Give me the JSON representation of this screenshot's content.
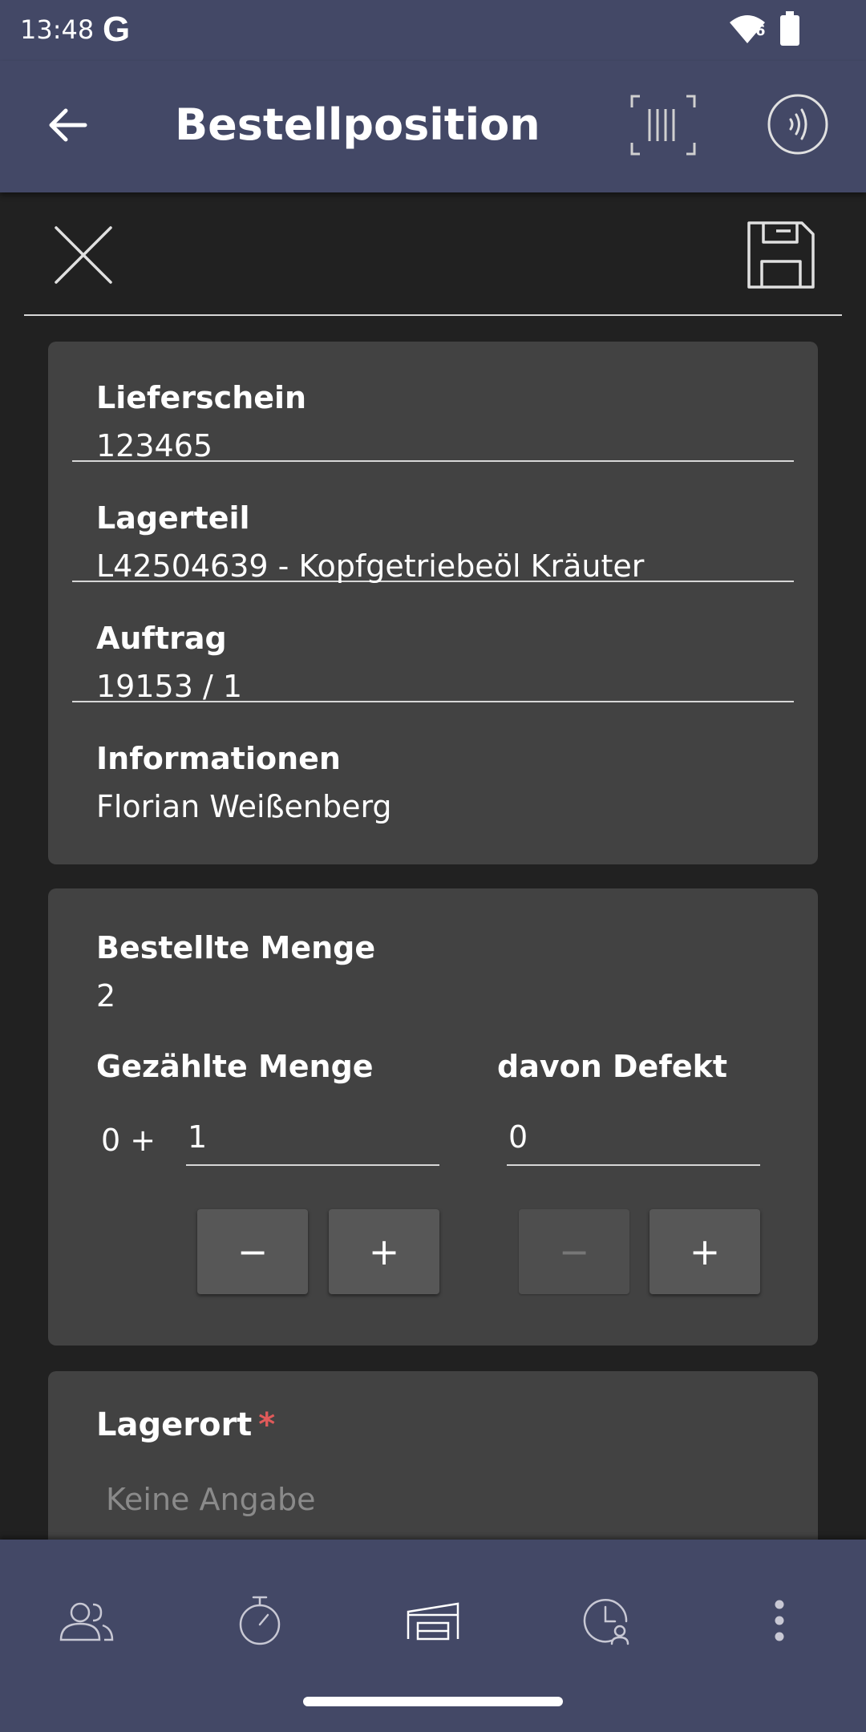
{
  "status_bar": {
    "time": "13:48",
    "google_glyph": "G",
    "wifi_badge": "6"
  },
  "app_bar": {
    "title": "Bestellposition"
  },
  "info_card": {
    "rows": [
      {
        "label": "Lieferschein",
        "value": "123465"
      },
      {
        "label": "Lagerteil",
        "value": "L42504639 - Kopfgetriebeöl Kräuter"
      },
      {
        "label": "Auftrag",
        "value": "19153 / 1"
      },
      {
        "label": "Informationen",
        "value": "Florian Weißenberg"
      }
    ]
  },
  "quantity_card": {
    "ordered_label": "Bestellte Menge",
    "ordered_value": "2",
    "counted_label": "Gezählte Menge",
    "counted_prefix": "0 +",
    "counted_value": "1",
    "defect_label": "davon Defekt",
    "defect_value": "0",
    "minus_symbol": "−",
    "plus_symbol": "+"
  },
  "location_card": {
    "label": "Lagerort",
    "required_marker": "*",
    "placeholder": "Keine Angabe"
  },
  "colors": {
    "bar_background": "#434866",
    "page_background": "#212121",
    "card_background": "#424242",
    "required": "#e05a5a"
  },
  "icons": {
    "back": "arrow-left-icon",
    "barcode": "barcode-scan-icon",
    "nfc": "nfc-icon",
    "close": "close-icon",
    "save": "save-icon",
    "nav": [
      "users-icon",
      "stopwatch-icon",
      "warehouse-icon",
      "time-person-icon",
      "more-vertical-icon"
    ]
  }
}
